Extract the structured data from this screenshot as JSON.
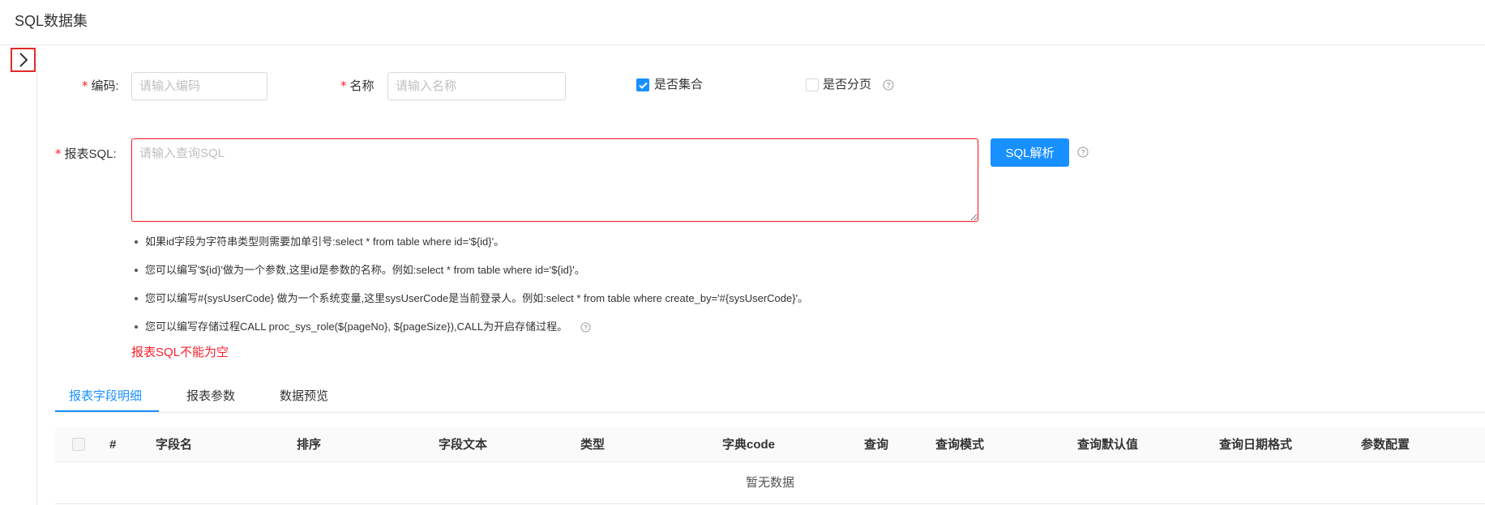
{
  "page": {
    "title": "SQL数据集"
  },
  "form": {
    "code": {
      "label": "编码:",
      "placeholder": "请输入编码"
    },
    "name": {
      "label": "名称",
      "placeholder": "请输入名称"
    },
    "is_collection": {
      "label": "是否集合",
      "checked": true
    },
    "is_paging": {
      "label": "是否分页",
      "checked": false
    },
    "sql": {
      "label": "报表SQL:",
      "placeholder": "请输入查询SQL",
      "value": ""
    },
    "parse_button": "SQL解析",
    "tips": [
      "如果id字段为字符串类型则需要加单引号:select * from table where id='${id}'。",
      "您可以编写'${id}'做为一个参数,这里id是参数的名称。例如:select * from table where id='${id}'。",
      "您可以编写#{sysUserCode} 做为一个系统变量,这里sysUserCode是当前登录人。例如:select * from table where create_by='#{sysUserCode}'。",
      "您可以编写存储过程CALL proc_sys_role(${pageNo}, ${pageSize}),CALL为开启存储过程。"
    ],
    "error": "报表SQL不能为空"
  },
  "tabs": [
    {
      "label": "报表字段明细",
      "active": true
    },
    {
      "label": "报表参数",
      "active": false
    },
    {
      "label": "数据预览",
      "active": false
    }
  ],
  "table": {
    "columns": [
      "#",
      "字段名",
      "排序",
      "字段文本",
      "类型",
      "字典code",
      "查询",
      "查询模式",
      "查询默认值",
      "查询日期格式",
      "参数配置"
    ],
    "empty_text": "暂无数据"
  },
  "colors": {
    "primary": "#1890ff",
    "error": "#f5222d",
    "border": "#d9d9d9"
  },
  "icons": {
    "toggle": "chevron-right-icon",
    "help": "question-circle-icon",
    "check": "check-icon"
  }
}
